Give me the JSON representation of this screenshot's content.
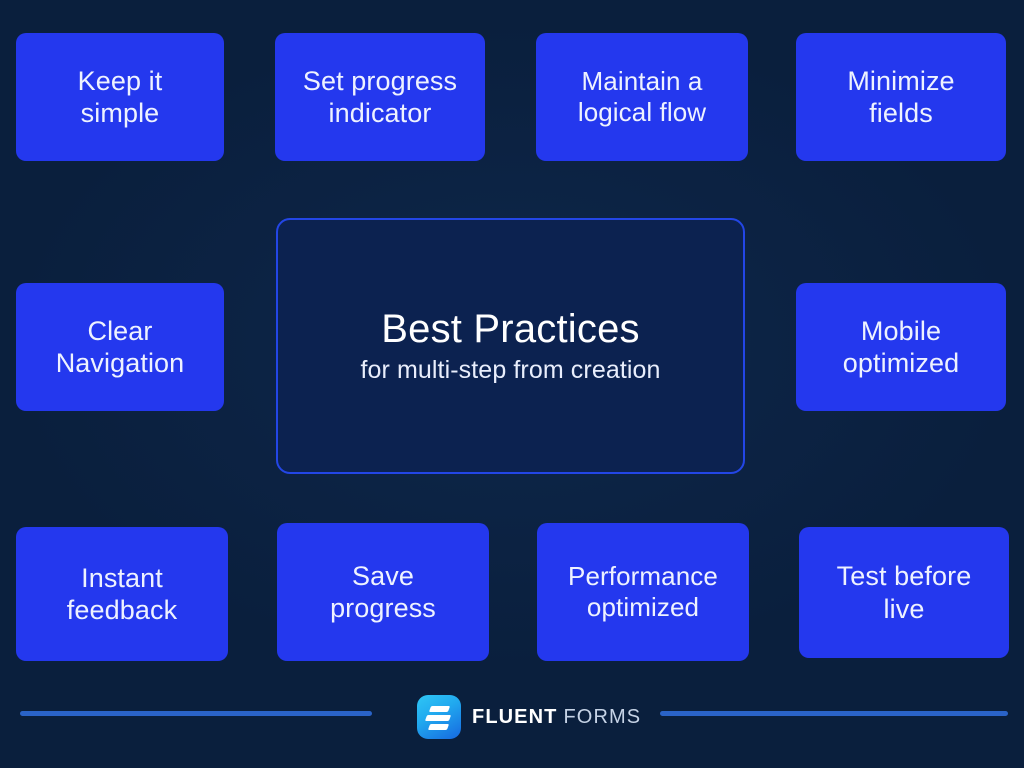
{
  "theme": {
    "background": "#0a1f3d",
    "card_blue": "#2438ee",
    "center_border": "#2346e6",
    "center_fill": "#0c2250",
    "rule_blue": "#2a63c8",
    "text_light": "#eef2ff"
  },
  "center": {
    "title": "Best Practices",
    "subtitle": "for multi-step from creation"
  },
  "cards": {
    "top": [
      {
        "label": "Keep it\nsimple"
      },
      {
        "label": "Set progress\nindicator"
      },
      {
        "label": "Maintain a\nlogical flow"
      },
      {
        "label": "Minimize\nfields"
      }
    ],
    "middle": [
      {
        "label": "Clear\nNavigation"
      },
      {
        "label": "Mobile\noptimized"
      }
    ],
    "bottom": [
      {
        "label": "Instant\nfeedback"
      },
      {
        "label": "Save\nprogress"
      },
      {
        "label": "Performance\noptimized"
      },
      {
        "label": "Test before\nlive"
      }
    ]
  },
  "footer": {
    "brand_primary": "FLUENT",
    "brand_secondary": "FORMS",
    "logo_icon": "fluent-forms-logo-icon"
  }
}
